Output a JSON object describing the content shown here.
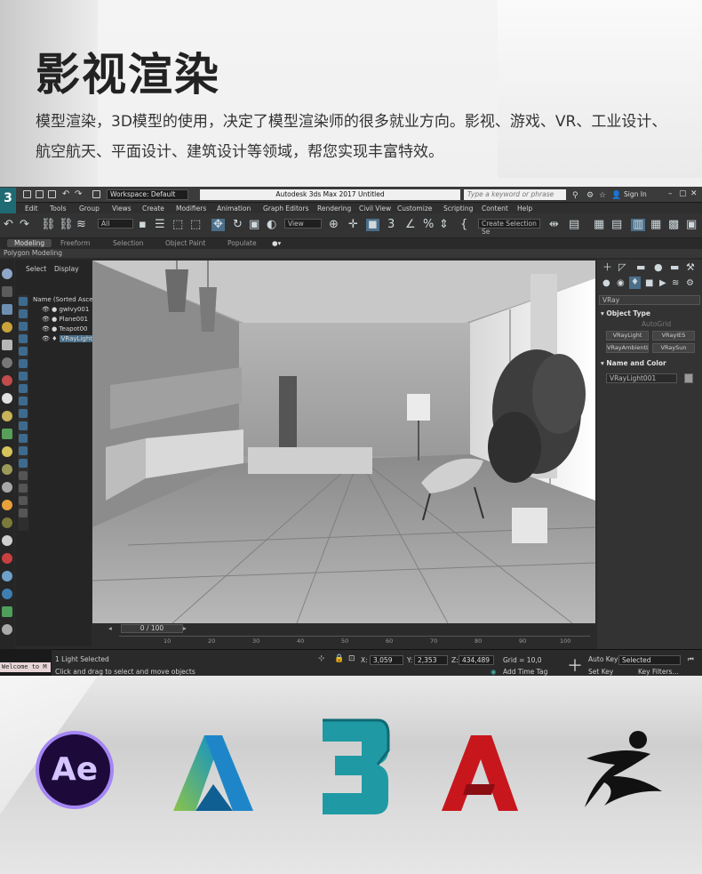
{
  "page": {
    "headline": "影视渲染",
    "description": "模型渲染，3D模型的使用，决定了模型渲染师的很多就业方向。影视、游戏、VR、工业设计、航空航天、平面设计、建筑设计等领域，帮您实现丰富特效。"
  },
  "app": {
    "logo_text": "3",
    "workspace_label": "Workspace: Default",
    "title": "Autodesk 3ds Max 2017    Untitled",
    "search_placeholder": "Type a keyword or phrase",
    "sign_in": "Sign In",
    "menu": [
      "Edit",
      "Tools",
      "Group",
      "Views",
      "Create",
      "Modifiers",
      "Animation",
      "Graph Editors",
      "Rendering",
      "Civil View",
      "Customize",
      "Scripting",
      "Content",
      "Help"
    ],
    "toolbar": {
      "filter": "All",
      "view": "View",
      "selection_set": "Create Selection Se"
    },
    "ribbon_tabs": [
      "Modeling",
      "Freeform",
      "Selection",
      "Object Paint",
      "Populate"
    ],
    "ribbon_sub": "Polygon Modeling",
    "scene_tabs": [
      "Select",
      "Display"
    ],
    "scene_tree": {
      "header": "Name (Sorted Ascen",
      "items": [
        "gwIvy001",
        "Plane001",
        "Teapot00",
        "VRayLight"
      ]
    },
    "timeline": {
      "frame": "0 / 100",
      "ticks": [
        "10",
        "20",
        "30",
        "40",
        "50",
        "60",
        "70",
        "80",
        "90",
        "100"
      ]
    },
    "command_panel": {
      "renderer": "VRay",
      "object_type_header": "Object Type",
      "autogrid": "AutoGrid",
      "buttons": [
        "VRayLight",
        "VRayIES",
        "VRayAmbientLig",
        "VRaySun"
      ],
      "name_color_header": "Name and Color",
      "object_name": "VRayLight001",
      "object_color": "#9a9a9a"
    },
    "status": {
      "maxscript": "Welcome to M",
      "selection": "1 Light Selected",
      "prompt": "Click and drag to select and move objects",
      "x_label": "X:",
      "x_value": "3,059",
      "y_label": "Y:",
      "y_value": "2,353",
      "z_label": "Z:",
      "z_value": "434,489",
      "grid": "Grid = 10,0",
      "add_time_tag": "Add Time Tag",
      "auto_key": "Auto Key",
      "set_key": "Set Key",
      "key_mode": "Selected",
      "key_filters": "Key Filters..."
    }
  },
  "logos": {
    "ae_text": "Ae",
    "names": [
      "after-effects",
      "autodesk",
      "3ds-max",
      "autocad",
      "zbrush"
    ]
  },
  "colors": {
    "accent_blue": "#3d6b8f",
    "ae_purple": "#a486f5",
    "max_teal": "#1f8f99",
    "autocad_red": "#c8161d"
  }
}
